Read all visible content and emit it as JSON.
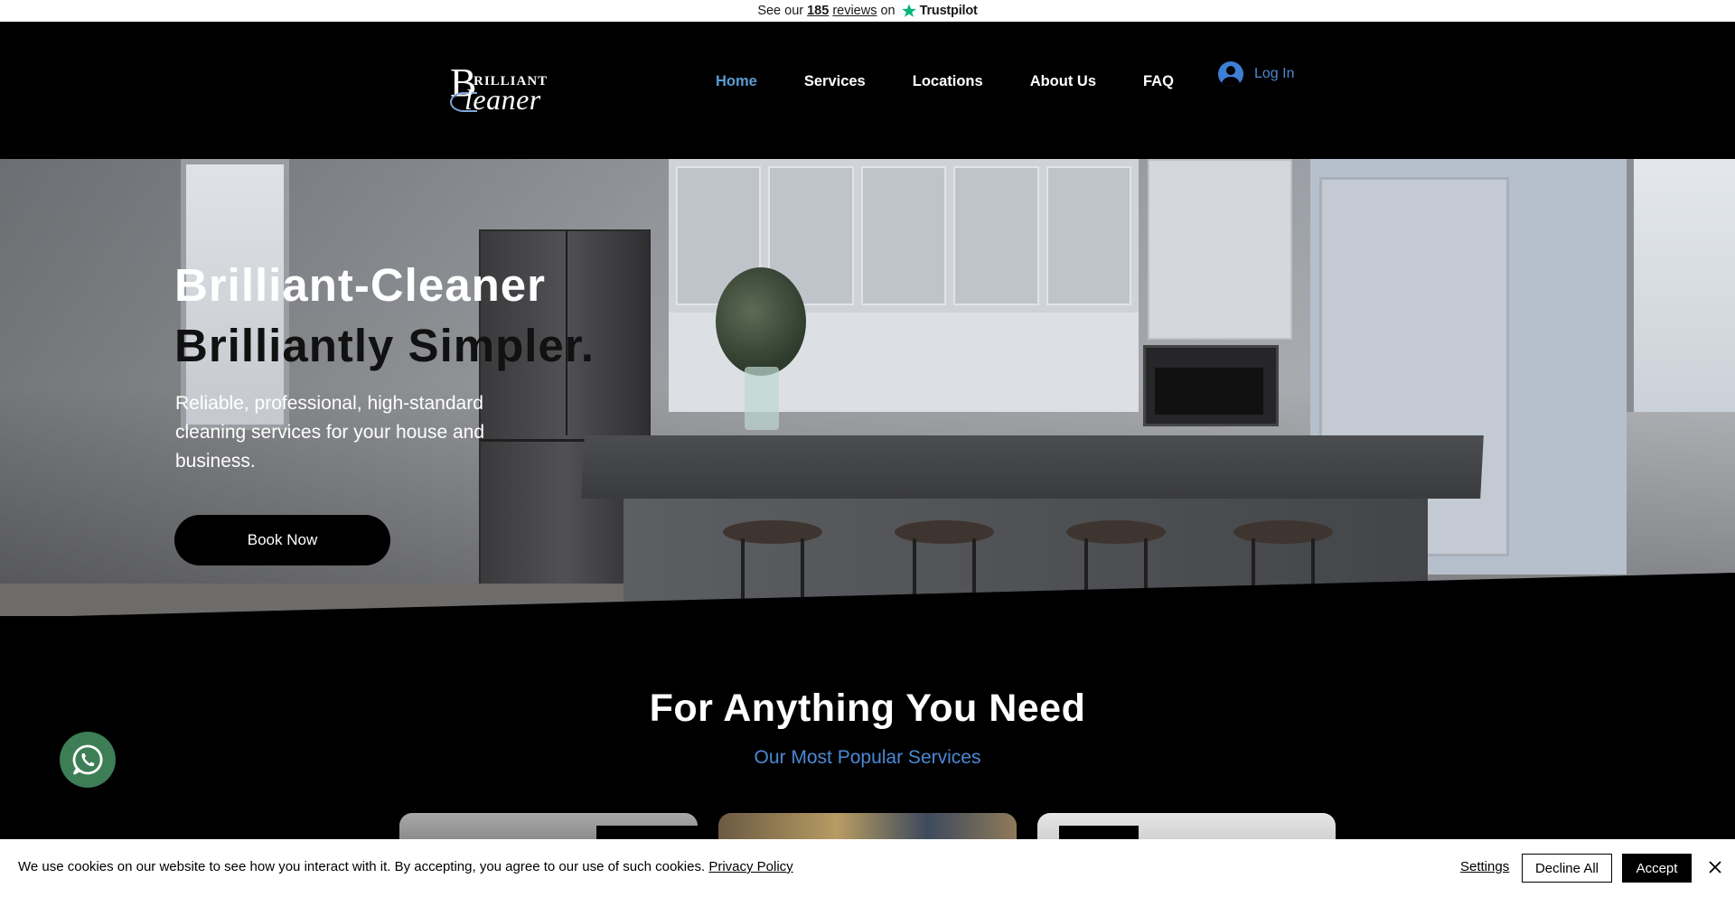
{
  "trustpilot": {
    "prefix": "See our",
    "count": "185",
    "reviews": "reviews",
    "on": "on",
    "brand": "Trustpilot",
    "star_color": "#00b67a"
  },
  "header": {
    "logo": {
      "b": "B",
      "rilliant": "RILLIANT",
      "cleaner": "leaner"
    },
    "nav": [
      "Home",
      "Services",
      "Locations",
      "About Us",
      "FAQ"
    ],
    "active_nav": "Home",
    "login": "Log In",
    "accent_color": "#4b88d4"
  },
  "hero": {
    "title_line1": "Brilliant-Cleaner",
    "title_line2": "Brilliantly Simpler.",
    "description": "Reliable, professional, high-standard cleaning services for your house and business.",
    "cta": "Book Now"
  },
  "services": {
    "title": "For Anything You Need",
    "subtitle": "Our Most Popular Services"
  },
  "whatsapp": {
    "icon": "whatsapp-icon",
    "color": "#3d7e57"
  },
  "cookie": {
    "text": "We use cookies on our website to see how you interact with it. By accepting, you agree to our use of such cookies.",
    "policy_link": "Privacy Policy",
    "settings": "Settings",
    "decline": "Decline All",
    "accept": "Accept"
  }
}
